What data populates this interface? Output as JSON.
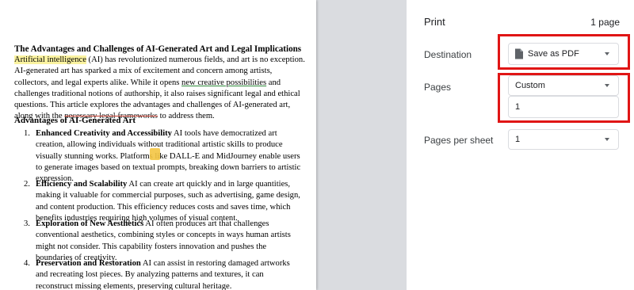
{
  "document": {
    "title": "The Advantages and Challenges of AI-Generated Art and Legal Implications",
    "intro": {
      "l1_hl": "Artificial intelligence",
      "l1_rest": " (AI) has revolutionized numerous fields, and art is no exception.",
      "l2": "AI-generated art has sparked a mix of excitement and concern among artists,",
      "l3_a": "collectors, and legal experts alike. While it opens ",
      "l3_ul": "new creative possibilities",
      "l3_b": " and",
      "l4": "challenges traditional notions of authorship, it also raises significant legal and ethical",
      "l5": "questions. This article explores the advantages and challenges of AI-generated art,",
      "l6_a": "along with the ",
      "l6_strike": "necessary legal frameworks",
      "l6_b": " to address them."
    },
    "section_title": "Advantages of AI-Generated Art",
    "items": [
      {
        "num": "1.",
        "heading": "Enhanced Creativity and Accessibility",
        "l1_rest": " AI tools have democratized art",
        "lines": [
          "creation, allowing individuals without traditional artistic skills to produce",
          "visually stunning works. Platforms like DALL-E and MidJourney enable users",
          "to generate images based on textual prompts, breaking down barriers to artistic",
          "expression."
        ]
      },
      {
        "num": "2.",
        "heading": "Efficiency and Scalability",
        "l1_rest": " AI can create art quickly and in large quantities,",
        "lines": [
          "making it valuable for commercial purposes, such as advertising, game design,",
          "and content production. This efficiency reduces costs and saves time, which",
          "benefits industries requiring high volumes of visual content."
        ]
      },
      {
        "num": "3.",
        "heading": "Exploration of New Aesthetics",
        "l1_rest": " AI often produces art that challenges",
        "lines": [
          "conventional aesthetics, combining styles or concepts in ways human artists",
          "might not consider. This capability fosters innovation and pushes the",
          "boundaries of creativity."
        ]
      },
      {
        "num": "4.",
        "heading": "Preservation and Restoration",
        "l1_rest": " AI can assist in restoring damaged artworks",
        "lines": [
          "and recreating lost pieces. By analyzing patterns and textures, it can",
          "reconstruct missing elements, preserving cultural heritage."
        ]
      }
    ]
  },
  "print_panel": {
    "title": "Print",
    "page_count": "1 page",
    "destination": {
      "label": "Destination",
      "value": "Save as PDF",
      "icon": "pdf-file-icon"
    },
    "pages": {
      "label": "Pages",
      "value": "Custom",
      "custom_value": "1"
    },
    "pages_per_sheet": {
      "label": "Pages per sheet",
      "value": "1"
    }
  },
  "colors": {
    "highlight_box": "#e01515",
    "preview_bg": "#dadce0",
    "text_highlight": "#fbf3a0"
  }
}
